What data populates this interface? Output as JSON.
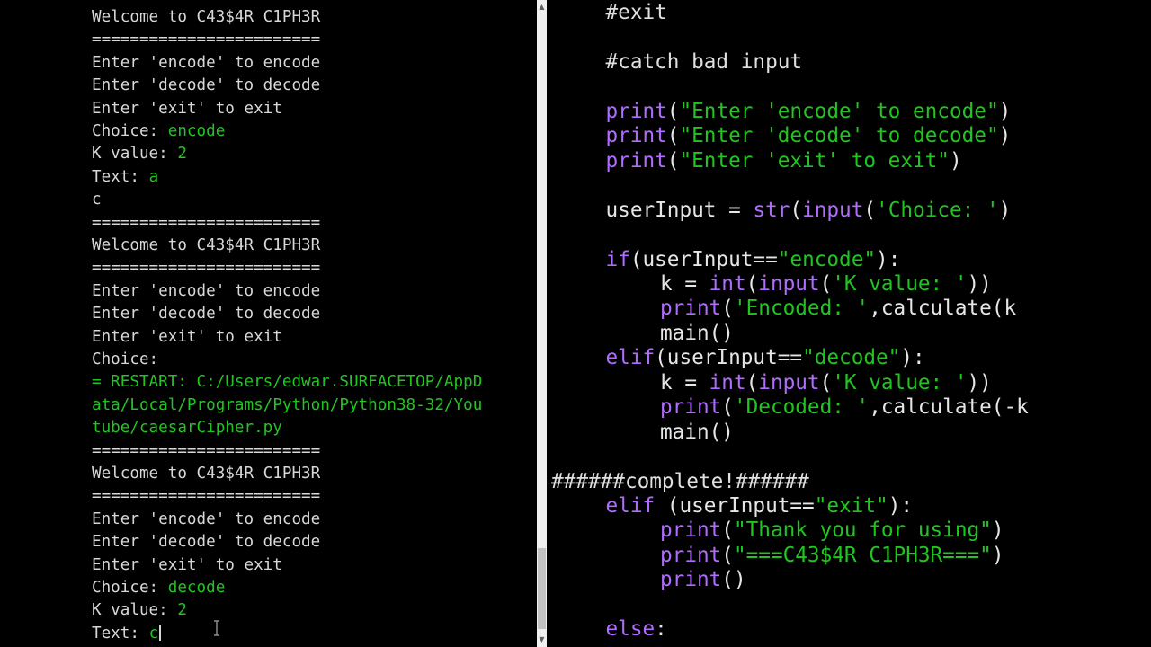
{
  "shell": {
    "lines": [
      {
        "text": "Welcome to C43$4R C1PH3R"
      },
      {
        "text": "========================"
      },
      {
        "text": "Enter 'encode' to encode"
      },
      {
        "text": "Enter 'decode' to decode"
      },
      {
        "text": "Enter 'exit' to exit"
      },
      {
        "text": "Choice: ",
        "input": "encode"
      },
      {
        "text": "K value: ",
        "input": "2"
      },
      {
        "text": "Text: ",
        "input": "a"
      },
      {
        "text": "c"
      },
      {
        "text": "========================"
      },
      {
        "text": "Welcome to C43$4R C1PH3R"
      },
      {
        "text": "========================"
      },
      {
        "text": "Enter 'encode' to encode"
      },
      {
        "text": "Enter 'decode' to decode"
      },
      {
        "text": "Enter 'exit' to exit"
      },
      {
        "text": "Choice: "
      },
      {
        "text": "= RESTART: C:/Users/edwar.SURFACETOP/AppD",
        "restart": true
      },
      {
        "text": "ata/Local/Programs/Python/Python38-32/You",
        "restart": true
      },
      {
        "text": "tube/caesarCipher.py",
        "restart": true
      },
      {
        "text": "========================"
      },
      {
        "text": "Welcome to C43$4R C1PH3R"
      },
      {
        "text": "========================"
      },
      {
        "text": "Enter 'encode' to encode"
      },
      {
        "text": "Enter 'decode' to decode"
      },
      {
        "text": "Enter 'exit' to exit"
      },
      {
        "text": "Choice: ",
        "input": "decode"
      },
      {
        "text": "K value: ",
        "input": "2"
      },
      {
        "text": "Text: ",
        "input": "c",
        "caret": true
      }
    ]
  },
  "editor": {
    "lines": [
      {
        "row": 0,
        "indent": 1,
        "tokens": [
          {
            "t": "#exit",
            "c": "cm"
          }
        ]
      },
      {
        "row": 2,
        "indent": 1,
        "tokens": [
          {
            "t": "#catch bad input",
            "c": "cm"
          }
        ]
      },
      {
        "row": 4,
        "indent": 1,
        "tokens": [
          {
            "t": "print",
            "c": "bi"
          },
          {
            "t": "(",
            "c": "df"
          },
          {
            "t": "\"Enter 'encode' to encode\"",
            "c": "st"
          },
          {
            "t": ")",
            "c": "df"
          }
        ]
      },
      {
        "row": 5,
        "indent": 1,
        "tokens": [
          {
            "t": "print",
            "c": "bi"
          },
          {
            "t": "(",
            "c": "df"
          },
          {
            "t": "\"Enter 'decode' to decode\"",
            "c": "st"
          },
          {
            "t": ")",
            "c": "df"
          }
        ]
      },
      {
        "row": 6,
        "indent": 1,
        "tokens": [
          {
            "t": "print",
            "c": "bi"
          },
          {
            "t": "(",
            "c": "df"
          },
          {
            "t": "\"Enter 'exit' to exit\"",
            "c": "st"
          },
          {
            "t": ")",
            "c": "df"
          }
        ]
      },
      {
        "row": 8,
        "indent": 1,
        "tokens": [
          {
            "t": "userInput = ",
            "c": "df"
          },
          {
            "t": "str",
            "c": "bi"
          },
          {
            "t": "(",
            "c": "df"
          },
          {
            "t": "input",
            "c": "bi"
          },
          {
            "t": "(",
            "c": "df"
          },
          {
            "t": "'Choice: '",
            "c": "st"
          },
          {
            "t": ")",
            "c": "df"
          }
        ]
      },
      {
        "row": 10,
        "indent": 1,
        "tokens": [
          {
            "t": "if",
            "c": "kw"
          },
          {
            "t": "(userInput==",
            "c": "df"
          },
          {
            "t": "\"encode\"",
            "c": "st"
          },
          {
            "t": "):",
            "c": "df"
          }
        ]
      },
      {
        "row": 11,
        "indent": 2,
        "tokens": [
          {
            "t": "k = ",
            "c": "df"
          },
          {
            "t": "int",
            "c": "bi"
          },
          {
            "t": "(",
            "c": "df"
          },
          {
            "t": "input",
            "c": "bi"
          },
          {
            "t": "(",
            "c": "df"
          },
          {
            "t": "'K value: '",
            "c": "st"
          },
          {
            "t": "))",
            "c": "df"
          }
        ]
      },
      {
        "row": 12,
        "indent": 2,
        "tokens": [
          {
            "t": "print",
            "c": "bi"
          },
          {
            "t": "(",
            "c": "df"
          },
          {
            "t": "'Encoded: '",
            "c": "st"
          },
          {
            "t": ",calculate(k",
            "c": "df"
          }
        ]
      },
      {
        "row": 13,
        "indent": 2,
        "tokens": [
          {
            "t": "main()",
            "c": "df"
          }
        ]
      },
      {
        "row": 14,
        "indent": 1,
        "tokens": [
          {
            "t": "elif",
            "c": "kw"
          },
          {
            "t": "(userInput==",
            "c": "df"
          },
          {
            "t": "\"decode\"",
            "c": "st"
          },
          {
            "t": "):",
            "c": "df"
          }
        ]
      },
      {
        "row": 15,
        "indent": 2,
        "tokens": [
          {
            "t": "k = ",
            "c": "df"
          },
          {
            "t": "int",
            "c": "bi"
          },
          {
            "t": "(",
            "c": "df"
          },
          {
            "t": "input",
            "c": "bi"
          },
          {
            "t": "(",
            "c": "df"
          },
          {
            "t": "'K value: '",
            "c": "st"
          },
          {
            "t": "))",
            "c": "df"
          }
        ]
      },
      {
        "row": 16,
        "indent": 2,
        "tokens": [
          {
            "t": "print",
            "c": "bi"
          },
          {
            "t": "(",
            "c": "df"
          },
          {
            "t": "'Decoded: '",
            "c": "st"
          },
          {
            "t": ",calculate(-k",
            "c": "df"
          }
        ]
      },
      {
        "row": 17,
        "indent": 2,
        "tokens": [
          {
            "t": "main()",
            "c": "df"
          }
        ]
      },
      {
        "row": 19,
        "indent": 0,
        "tokens": [
          {
            "t": "######complete!######",
            "c": "cm"
          }
        ]
      },
      {
        "row": 20,
        "indent": 1,
        "tokens": [
          {
            "t": "elif",
            "c": "kw"
          },
          {
            "t": " (userInput==",
            "c": "df"
          },
          {
            "t": "\"exit\"",
            "c": "st"
          },
          {
            "t": "):",
            "c": "df"
          }
        ]
      },
      {
        "row": 21,
        "indent": 2,
        "tokens": [
          {
            "t": "print",
            "c": "bi"
          },
          {
            "t": "(",
            "c": "df"
          },
          {
            "t": "\"Thank you for using\"",
            "c": "st"
          },
          {
            "t": ")",
            "c": "df"
          }
        ]
      },
      {
        "row": 22,
        "indent": 2,
        "tokens": [
          {
            "t": "print",
            "c": "bi"
          },
          {
            "t": "(",
            "c": "df"
          },
          {
            "t": "\"===C43$4R C1PH3R===\"",
            "c": "st"
          },
          {
            "t": ")",
            "c": "df"
          }
        ]
      },
      {
        "row": 23,
        "indent": 2,
        "tokens": [
          {
            "t": "print",
            "c": "bi"
          },
          {
            "t": "()",
            "c": "df"
          }
        ]
      },
      {
        "row": 25,
        "indent": 1,
        "tokens": [
          {
            "t": "else",
            "c": "kw"
          },
          {
            "t": ":",
            "c": "df"
          }
        ]
      }
    ]
  },
  "colors": {
    "background": "#000000",
    "shell_text": "#d8d8d8",
    "user_input": "#22c422",
    "keyword": "#b06cff",
    "string": "#22c422",
    "scrollbar": "#f0f0f0"
  },
  "icons": {
    "scroll_up": "arrow-up-icon",
    "scroll_down": "arrow-down-icon",
    "mouse_cursor": "text-cursor-icon"
  }
}
